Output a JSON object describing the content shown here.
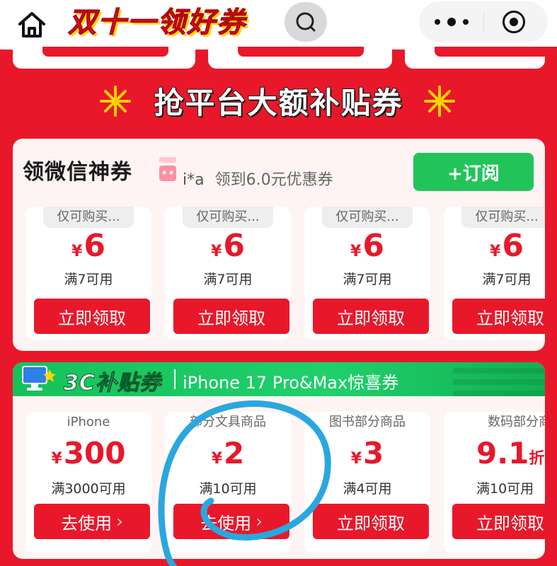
{
  "header": {
    "title": "双十一领好券",
    "home_icon": "home-icon",
    "search_icon": "search-icon",
    "more_icon": "more-icon",
    "target_icon": "target-icon"
  },
  "section_title": "抢平台大额补贴券",
  "wechat_panel": {
    "title": "领微信神券",
    "user": "i*a",
    "notice_prefix": "领到",
    "notice_amount": "6.0",
    "notice_suffix": "元优惠券",
    "subscribe_label": "+订阅",
    "coupons": [
      {
        "tag": "仅可购买...",
        "currency": "¥",
        "amount": "6",
        "condition": "满7可用",
        "button": "立即领取"
      },
      {
        "tag": "仅可购买...",
        "currency": "¥",
        "amount": "6",
        "condition": "满7可用",
        "button": "立即领取"
      },
      {
        "tag": "仅可购买...",
        "currency": "¥",
        "amount": "6",
        "condition": "满7可用",
        "button": "立即领取"
      },
      {
        "tag": "仅可购买...",
        "currency": "¥",
        "amount": "6",
        "condition": "满7可用",
        "button": "立即领取"
      }
    ]
  },
  "subsidy_panel": {
    "title": "3C补贴券",
    "subtitle": "iPhone 17 Pro&Max惊喜券",
    "coupons": [
      {
        "tag": "iPhone",
        "currency": "¥",
        "amount": "300",
        "condition": "满3000可用",
        "button": "去使用",
        "arrow": "›"
      },
      {
        "tag": "部分文具商品",
        "currency": "¥",
        "amount": "2",
        "condition": "满10可用",
        "button": "去使用",
        "arrow": "›"
      },
      {
        "tag": "图书部分商品",
        "currency": "¥",
        "amount": "3",
        "condition": "满4可用",
        "button": "立即领取",
        "arrow": ""
      },
      {
        "tag": "数码部分商",
        "currency": "",
        "amount": "9.1",
        "unit": "折",
        "condition": "满10可用",
        "button": "立即领取",
        "arrow": ""
      }
    ]
  },
  "colors": {
    "brand_red": "#e8182a",
    "wechat_green": "#22c45a",
    "annotation_blue": "#2aa7e0"
  }
}
